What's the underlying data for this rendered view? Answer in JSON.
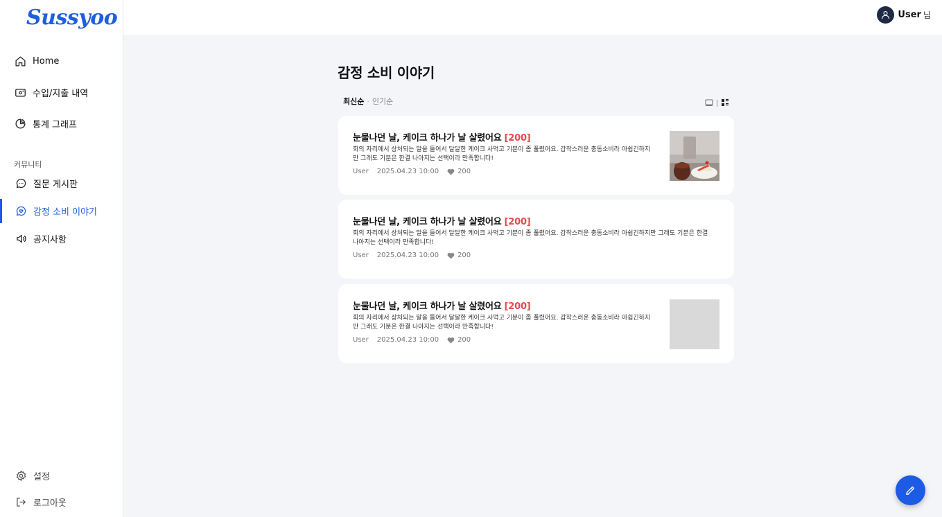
{
  "brand": {
    "logo_text": "Sussyoo",
    "accent": "#1d5ae6"
  },
  "sidebar": {
    "items": [
      {
        "label": "Home",
        "icon": "home-icon"
      },
      {
        "label": "수입/지출 내역",
        "icon": "wallet-icon"
      },
      {
        "label": "통계 그래프",
        "icon": "pie-chart-icon"
      }
    ],
    "section_label": "커뮤니티",
    "community": [
      {
        "label": "질문 게시판",
        "icon": "chat-bubble-icon"
      },
      {
        "label": "감정 소비 이야기",
        "icon": "heart-bubble-icon",
        "active": true
      },
      {
        "label": "공지사항",
        "icon": "megaphone-icon"
      }
    ],
    "footer": [
      {
        "label": "설정",
        "icon": "gear-icon"
      },
      {
        "label": "로그아웃",
        "icon": "logout-icon"
      }
    ]
  },
  "header": {
    "user_name": "User",
    "user_suffix": "님"
  },
  "main": {
    "title": "감정 소비 이야기",
    "sort": {
      "active": "최신순",
      "separator": "·",
      "inactive": "인기순"
    },
    "view_toggle": [
      "card-view-icon",
      "list-view-icon"
    ]
  },
  "posts": [
    {
      "title": "눈물나던 날, 케이크 하나가 날 살렸어요",
      "comment_count": "[200]",
      "body_lines": [
        "회의 자리에서 상처되는 말을 들어서 달달한 케이크 사먹고 기분이 좀 풀렸어요. 갑작스러운 충동소비라 아쉽긴하지",
        "만 그래도 기분은 한결 나아지는 선택이라 만족합니다!"
      ],
      "author": "User",
      "date": "2025.04.23 10:00",
      "likes": "200",
      "thumbnail": "photo"
    },
    {
      "title": "눈물나던 날, 케이크 하나가 날 살렸어요",
      "comment_count": "[200]",
      "body_lines": [
        "회의 자리에서 상처되는 말을 들어서 달달한 케이크 사먹고 기분이 좀 풀렸어요. 갑작스러운 충동소비라 아쉽긴하지만 그래도 기분은 한결",
        "나아지는 선택이라 만족합니다!"
      ],
      "author": "User",
      "date": "2025.04.23 10:00",
      "likes": "200",
      "thumbnail": "none"
    },
    {
      "title": "눈물나던 날, 케이크 하나가 날 살렸어요",
      "comment_count": "[200]",
      "body_lines": [
        "회의 자리에서 상처되는 말을 들어서 달달한 케이크 사먹고 기분이 좀 풀렸어요. 갑작스러운 충동소비라 아쉽긴하지",
        "만 그래도 기분은 한결 나아지는 선택이라 만족합니다!"
      ],
      "author": "User",
      "date": "2025.04.23 10:00",
      "likes": "200",
      "thumbnail": "placeholder"
    }
  ],
  "fab": {
    "icon": "pencil-icon"
  }
}
